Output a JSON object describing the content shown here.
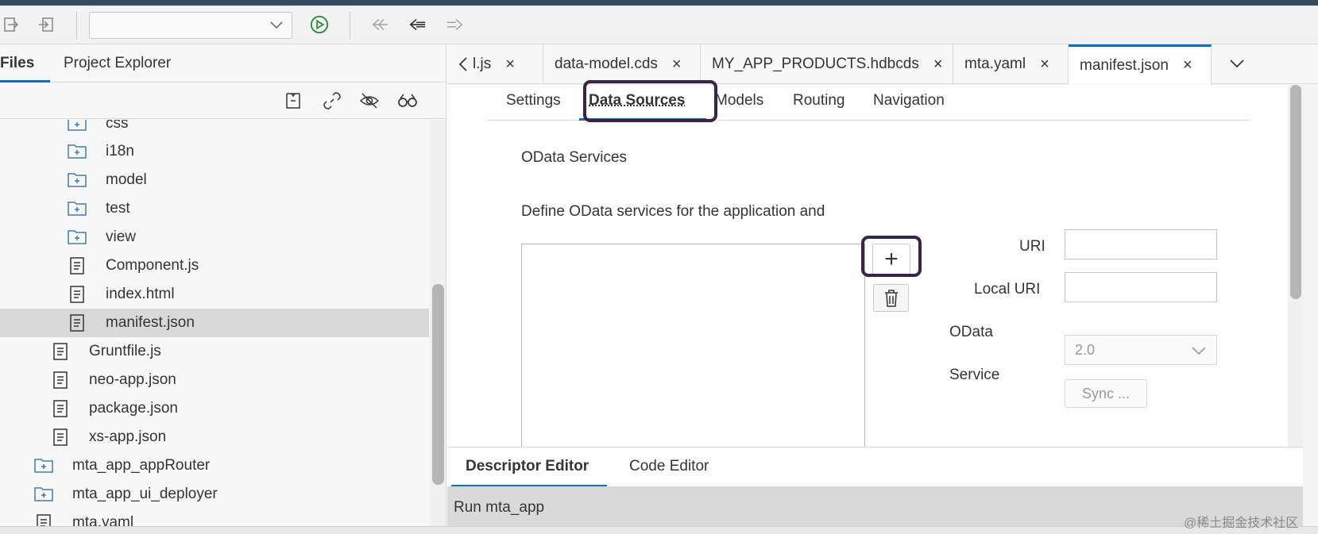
{
  "toolbar": {
    "selector_value": "",
    "icons": [
      "export-icon",
      "import-icon",
      "chevron-down-icon",
      "run-icon",
      "step-back-icon",
      "back-icon",
      "forward-icon"
    ]
  },
  "left_panel": {
    "tabs": [
      {
        "label": "Files",
        "active": true
      },
      {
        "label": "Project Explorer",
        "active": false
      }
    ],
    "tools": [
      "collapse-all-icon",
      "link-icon",
      "hide-icon",
      "search-icon"
    ],
    "tree": [
      {
        "label": "css",
        "type": "folder"
      },
      {
        "label": "i18n",
        "type": "folder"
      },
      {
        "label": "model",
        "type": "folder"
      },
      {
        "label": "test",
        "type": "folder"
      },
      {
        "label": "view",
        "type": "folder"
      },
      {
        "label": "Component.js",
        "type": "file"
      },
      {
        "label": "index.html",
        "type": "file"
      },
      {
        "label": "manifest.json",
        "type": "file",
        "selected": true
      },
      {
        "label": "Gruntfile.js",
        "type": "file"
      },
      {
        "label": "neo-app.json",
        "type": "file"
      },
      {
        "label": "package.json",
        "type": "file"
      },
      {
        "label": "xs-app.json",
        "type": "file"
      },
      {
        "label": "mta_app_appRouter",
        "type": "folder"
      },
      {
        "label": "mta_app_ui_deployer",
        "type": "folder"
      },
      {
        "label": "mta.yaml",
        "type": "file"
      }
    ]
  },
  "editor_tabs": [
    {
      "label": "l.js",
      "active": false
    },
    {
      "label": "data-model.cds",
      "active": false
    },
    {
      "label": "MY_APP_PRODUCTS.hdbcds",
      "active": false
    },
    {
      "label": "mta.yaml",
      "active": false
    },
    {
      "label": "manifest.json",
      "active": true
    }
  ],
  "close_glyph": "×",
  "descriptor": {
    "subtabs": [
      {
        "label": "Settings",
        "active": false
      },
      {
        "label": "Data Sources",
        "active": true
      },
      {
        "label": "Models",
        "active": false
      },
      {
        "label": "Routing",
        "active": false
      },
      {
        "label": "Navigation",
        "active": false
      }
    ],
    "section_title": "OData Services",
    "section_desc": "Define OData services for the application and",
    "add_label": "+",
    "fields": {
      "uri_label": "URI",
      "uri_value": "",
      "local_uri_label": "Local URI",
      "local_uri_value": "",
      "odata_label": "OData",
      "odata_value": "2.0",
      "service_label": "Service",
      "sync_label": "Sync ..."
    }
  },
  "bottom_tabs": [
    {
      "label": "Descriptor Editor",
      "active": true
    },
    {
      "label": "Code Editor",
      "active": false
    }
  ],
  "run_bar": {
    "label": "Run mta_app"
  },
  "watermark": "@稀土掘金技术社区",
  "colors": {
    "accent": "#0a6ed1",
    "highlight": "#3b2247",
    "run_green": "#2b8a3e",
    "header": "#354a5f"
  }
}
